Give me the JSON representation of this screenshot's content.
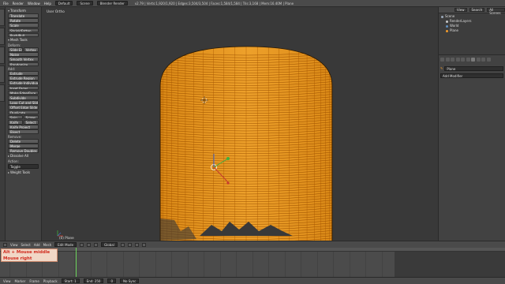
{
  "topbar": {
    "menus": [
      "File",
      "Render",
      "Window",
      "Help"
    ],
    "layout": "Default",
    "scene": "Scene",
    "engine": "Blender Render",
    "stats": "v2.79 | Verts:1,920/1,920 | Edges:3,504/3,504 | Faces:1,584/1,584 | Tris:3,168 | Mem:16.40M | Plane"
  },
  "toolshelf": {
    "transform_header": "Transform",
    "transform_tools": [
      "Translate",
      "Rotate",
      "Scale",
      "Shrink/Fatten",
      "Push/Pull"
    ],
    "mesh_tools_header": "Mesh Tools",
    "deform_label": "Deform:",
    "deform_tools": [
      [
        "Slide Ed",
        "Vertex"
      ]
    ],
    "deform_more": [
      "Noise",
      "Smooth Vertex",
      "Randomize"
    ],
    "add_label": "Add:",
    "add_tools": [
      "Extrude",
      "Extrude Region",
      "Extrude Individual",
      "Inset Faces",
      "Make Edge/Face",
      "Subdivide",
      "Loop Cut and Slide",
      "Offset Edge Slide",
      "Duplicate"
    ],
    "spin_row": [
      "Spin",
      "Screw"
    ],
    "knife_row": [
      "Knife",
      "Select"
    ],
    "add_tools2": [
      "Knife Project",
      "Bisect"
    ],
    "remove_label": "Remove:",
    "remove_tools": [
      "Delete",
      "Merge",
      "Remove Doubles"
    ],
    "dissolve_header": "Dissolve All",
    "action_label": "Action:",
    "action_value": "Toggle",
    "weight_header": "Weight Tools"
  },
  "viewport": {
    "view_label": "User Ortho",
    "object_label": "(0) Plane"
  },
  "outliner": {
    "tabs": [
      "View",
      "Search",
      "All Scenes"
    ],
    "items": [
      {
        "label": "Scene",
        "color": "#9aa8b8"
      },
      {
        "label": "RenderLayers",
        "color": "#c8c8c8"
      },
      {
        "label": "World",
        "color": "#5f8fc0"
      },
      {
        "label": "Plane",
        "color": "#f09a2b"
      }
    ]
  },
  "properties": {
    "object_name": "Plane",
    "add_modifier": "Add Modifier"
  },
  "viewport_header": {
    "menus": [
      "View",
      "Select",
      "Add",
      "Mesh"
    ],
    "mode": "Edit Mode",
    "pivot": "Global"
  },
  "keys_overlay": {
    "line1": "Alt + Mouse middle",
    "line2": "Mouse right"
  },
  "timeline": {
    "menus": [
      "View",
      "Marker",
      "Frame",
      "Playback"
    ],
    "start_label": "Start:",
    "start_value": "1",
    "end_label": "End:",
    "end_value": "250",
    "current_frame": "0",
    "sync": "No Sync"
  },
  "colors": {
    "mesh_orange": "#f39a1c",
    "mesh_edge": "#b85d00",
    "keys_red": "#d02a1d",
    "playhead": "#6bd25b"
  }
}
